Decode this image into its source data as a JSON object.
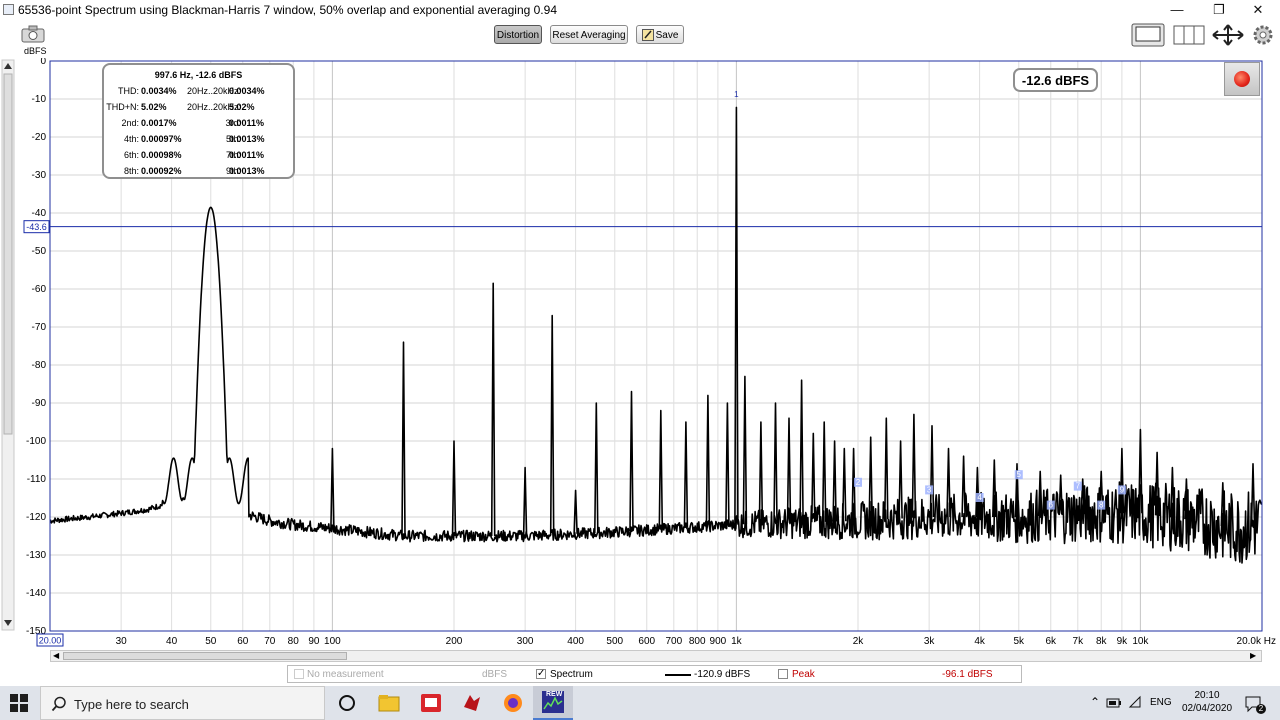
{
  "window": {
    "title": "65536-point Spectrum using Blackman-Harris 7 window, 50% overlap and exponential averaging 0.94",
    "minimize": "—",
    "restore": "❐",
    "close": "✕"
  },
  "toolbar": {
    "distortion_label": "Distortion",
    "reset_label": "Reset Averaging",
    "save_label": "Save",
    "unit_label": "dBFS"
  },
  "distortion_panel": {
    "header": "997.6 Hz, -12.6 dBFS",
    "rows": [
      {
        "l1": "THD:",
        "v1": "0.0034%",
        "l2": "20Hz..20kHz:",
        "v2": "0.0034%"
      },
      {
        "l1": "THD+N:",
        "v1": "5.02%",
        "l2": "20Hz..20kHz:",
        "v2": "5.02%"
      },
      {
        "l1": "2nd:",
        "v1": "0.0017%",
        "l2": "3rd:",
        "v2": "0.0011%"
      },
      {
        "l1": "4th:",
        "v1": "0.00097%",
        "l2": "5th:",
        "v2": "0.0013%"
      },
      {
        "l1": "6th:",
        "v1": "0.00098%",
        "l2": "7th:",
        "v2": "0.0011%"
      },
      {
        "l1": "8th:",
        "v1": "0.00092%",
        "l2": "9th:",
        "v2": "0.0013%"
      }
    ]
  },
  "level_readout": "-12.6 dBFS",
  "cursor_readout": "-43.6",
  "x_start_readout": "20.00",
  "legend": {
    "no_measurement": "No measurement",
    "no_measurement_unit": "dBFS",
    "spectrum": "Spectrum",
    "spectrum_value": "-120.9 dBFS",
    "peak": "Peak",
    "peak_value": "-96.1 dBFS",
    "checked_mark": "✓"
  },
  "taskbar": {
    "search_placeholder": "Type here to search",
    "lang": "ENG",
    "time": "20:10",
    "date": "02/04/2020",
    "notify_count": "2",
    "rew_label": "REW"
  },
  "chart_data": {
    "type": "line",
    "title": "",
    "xlabel": "",
    "ylabel": "dBFS",
    "x_scale": "log",
    "xlim": [
      20,
      20000
    ],
    "ylim": [
      -150,
      0
    ],
    "x_unit": "Hz",
    "grid": true,
    "yticks": [
      0,
      -10,
      -20,
      -30,
      -40,
      -50,
      -60,
      -70,
      -80,
      -90,
      -100,
      -110,
      -120,
      -130,
      -140,
      -150
    ],
    "xticks": [
      {
        "v": 30,
        "label": "30"
      },
      {
        "v": 40,
        "label": "40"
      },
      {
        "v": 50,
        "label": "50"
      },
      {
        "v": 60,
        "label": "60"
      },
      {
        "v": 70,
        "label": "70"
      },
      {
        "v": 80,
        "label": "80"
      },
      {
        "v": 90,
        "label": "90"
      },
      {
        "v": 100,
        "label": "100"
      },
      {
        "v": 200,
        "label": "200"
      },
      {
        "v": 300,
        "label": "300"
      },
      {
        "v": 400,
        "label": "400"
      },
      {
        "v": 500,
        "label": "500"
      },
      {
        "v": 600,
        "label": "600"
      },
      {
        "v": 700,
        "label": "700"
      },
      {
        "v": 800,
        "label": "800"
      },
      {
        "v": 900,
        "label": "900"
      },
      {
        "v": 1000,
        "label": "1k"
      },
      {
        "v": 2000,
        "label": "2k"
      },
      {
        "v": 3000,
        "label": "3k"
      },
      {
        "v": 4000,
        "label": "4k"
      },
      {
        "v": 5000,
        "label": "5k"
      },
      {
        "v": 6000,
        "label": "6k"
      },
      {
        "v": 7000,
        "label": "7k"
      },
      {
        "v": 8000,
        "label": "8k"
      },
      {
        "v": 9000,
        "label": "9k"
      },
      {
        "v": 10000,
        "label": "10k"
      },
      {
        "v": 20000,
        "label": "20.0k Hz"
      }
    ],
    "cursor_level": -43.6,
    "series": [
      {
        "name": "Spectrum",
        "color": "#000000",
        "baseline": [
          [
            20,
            -121
          ],
          [
            25,
            -120
          ],
          [
            30,
            -119
          ],
          [
            35,
            -118
          ],
          [
            40,
            -116
          ],
          [
            45,
            -115
          ],
          [
            55,
            -116
          ],
          [
            60,
            -119
          ],
          [
            70,
            -121
          ],
          [
            80,
            -122
          ],
          [
            100,
            -123
          ],
          [
            150,
            -125
          ],
          [
            200,
            -125
          ],
          [
            300,
            -125
          ],
          [
            500,
            -124
          ],
          [
            700,
            -123
          ],
          [
            1000,
            -122
          ],
          [
            2000,
            -121
          ],
          [
            3000,
            -120
          ],
          [
            5000,
            -120
          ],
          [
            8000,
            -119
          ],
          [
            10000,
            -119
          ],
          [
            14000,
            -121
          ],
          [
            17000,
            -123
          ],
          [
            20000,
            -122
          ]
        ],
        "broad_peak": {
          "freq": 50,
          "level": -38.5
        },
        "peaks": [
          [
            100,
            -102
          ],
          [
            200,
            -100
          ],
          [
            150,
            -74
          ],
          [
            250,
            -58.5
          ],
          [
            300,
            -107
          ],
          [
            350,
            -67
          ],
          [
            400,
            -113
          ],
          [
            450,
            -90
          ],
          [
            550,
            -87
          ],
          [
            650,
            -92
          ],
          [
            750,
            -95
          ],
          [
            850,
            -88
          ],
          [
            950,
            -90
          ],
          [
            1000,
            -12.2
          ],
          [
            1050,
            -83
          ],
          [
            1150,
            -95
          ],
          [
            1250,
            -90
          ],
          [
            1350,
            -94
          ],
          [
            1450,
            -84
          ],
          [
            1550,
            -98
          ],
          [
            1650,
            -95
          ],
          [
            1750,
            -100
          ],
          [
            1850,
            -102
          ],
          [
            1950,
            -102
          ],
          [
            2150,
            -99
          ],
          [
            2350,
            -94
          ],
          [
            2550,
            -100
          ],
          [
            2750,
            -93
          ],
          [
            3050,
            -96
          ],
          [
            3350,
            -102
          ],
          [
            3650,
            -104
          ],
          [
            3950,
            -107
          ],
          [
            4350,
            -105
          ],
          [
            4950,
            -106
          ],
          [
            5650,
            -108
          ],
          [
            6350,
            -109
          ],
          [
            7200,
            -110
          ],
          [
            8000,
            -108
          ],
          [
            9000,
            -102
          ],
          [
            10000,
            -97
          ],
          [
            11000,
            -103
          ],
          [
            12000,
            -107
          ],
          [
            13000,
            -110
          ],
          [
            16000,
            -111
          ],
          [
            19000,
            -106
          ]
        ]
      }
    ],
    "harmonic_markers": [
      {
        "label": "1",
        "freq": 1000,
        "level": -9
      },
      {
        "label": "2",
        "freq": 2000,
        "level": -111
      },
      {
        "label": "3",
        "freq": 3000,
        "level": -113
      },
      {
        "label": "4",
        "freq": 4000,
        "level": -115
      },
      {
        "label": "5",
        "freq": 5000,
        "level": -109
      },
      {
        "label": "6",
        "freq": 6000,
        "level": -117
      },
      {
        "label": "7",
        "freq": 7000,
        "level": -112
      },
      {
        "label": "8",
        "freq": 8000,
        "level": -117
      },
      {
        "label": "9",
        "freq": 9000,
        "level": -113
      }
    ]
  }
}
